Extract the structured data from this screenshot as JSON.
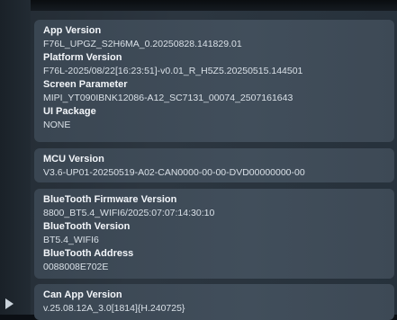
{
  "groups": [
    {
      "items": [
        {
          "label": "App Version",
          "value": "F76L_UPGZ_S2H6MA_0.20250828.141829.01"
        },
        {
          "label": "Platform Version",
          "value": "F76L-2025/08/22[16:23:51]-v0.01_R_H5Z5.20250515.144501"
        },
        {
          "label": "Screen Parameter",
          "value": "MIPI_YT090IBNK12086-A12_SC7131_00074_2507161643"
        },
        {
          "label": "UI Package",
          "value": "NONE"
        }
      ]
    },
    {
      "items": [
        {
          "label": "MCU Version",
          "value": "V3.6-UP01-20250519-A02-CAN0000-00-00-DVD00000000-00"
        }
      ]
    },
    {
      "items": [
        {
          "label": "BlueTooth Firmware Version",
          "value": "8800_BT5.4_WIFI6/2025:07:07:14:30:10"
        },
        {
          "label": "BlueTooth Version",
          "value": "BT5.4_WIFI6"
        },
        {
          "label": "BlueTooth Address",
          "value": "0088008E702E"
        }
      ]
    },
    {
      "items": [
        {
          "label": "Can App Version",
          "value": "v.25.08.12A_3.0[1814]{H.240725}"
        }
      ]
    }
  ],
  "icons": {
    "back": "play-arrow-icon"
  },
  "colors": {
    "card": "#3d4955",
    "label": "#f3f6fa",
    "value": "#d9e0e7"
  }
}
